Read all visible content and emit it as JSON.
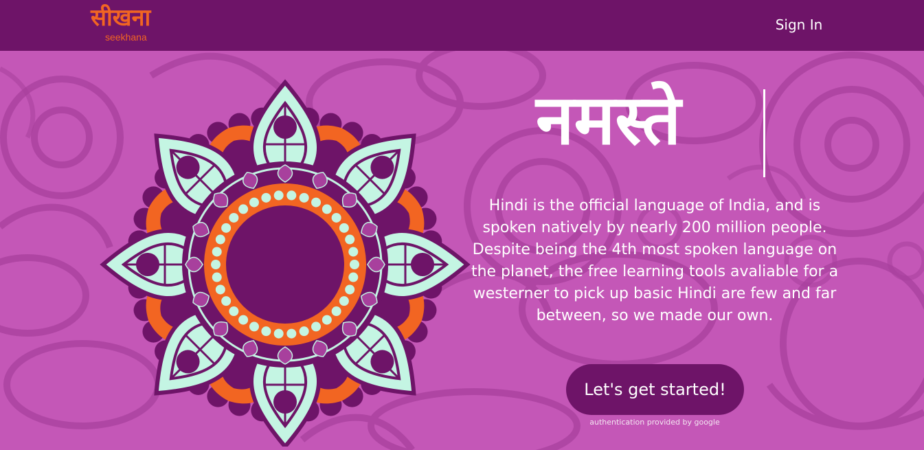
{
  "colors": {
    "background": "#c457b7",
    "header": "#6e1468",
    "accent_orange": "#f26522",
    "mint": "#c4f5e3",
    "deep_purple": "#6e1468",
    "text": "#ffffff"
  },
  "header": {
    "logo_hindi": "सीखना",
    "logo_latin": "seekhana",
    "signin_label": "Sign In"
  },
  "hero": {
    "headline": "नमस्ते",
    "description": "Hindi is the official language of India, and is spoken natively by nearly 200 million people. Despite being the 4th most spoken language on the planet, the free learning tools avaliable for a westerner to pick up basic Hindi are few and far between, so we made our own.",
    "cta_label": "Let's get started!",
    "auth_note": "authentication provided by google"
  },
  "icons": {
    "background_pattern": "paisley-mandala-pattern",
    "illustration": "mandala-illustration"
  }
}
